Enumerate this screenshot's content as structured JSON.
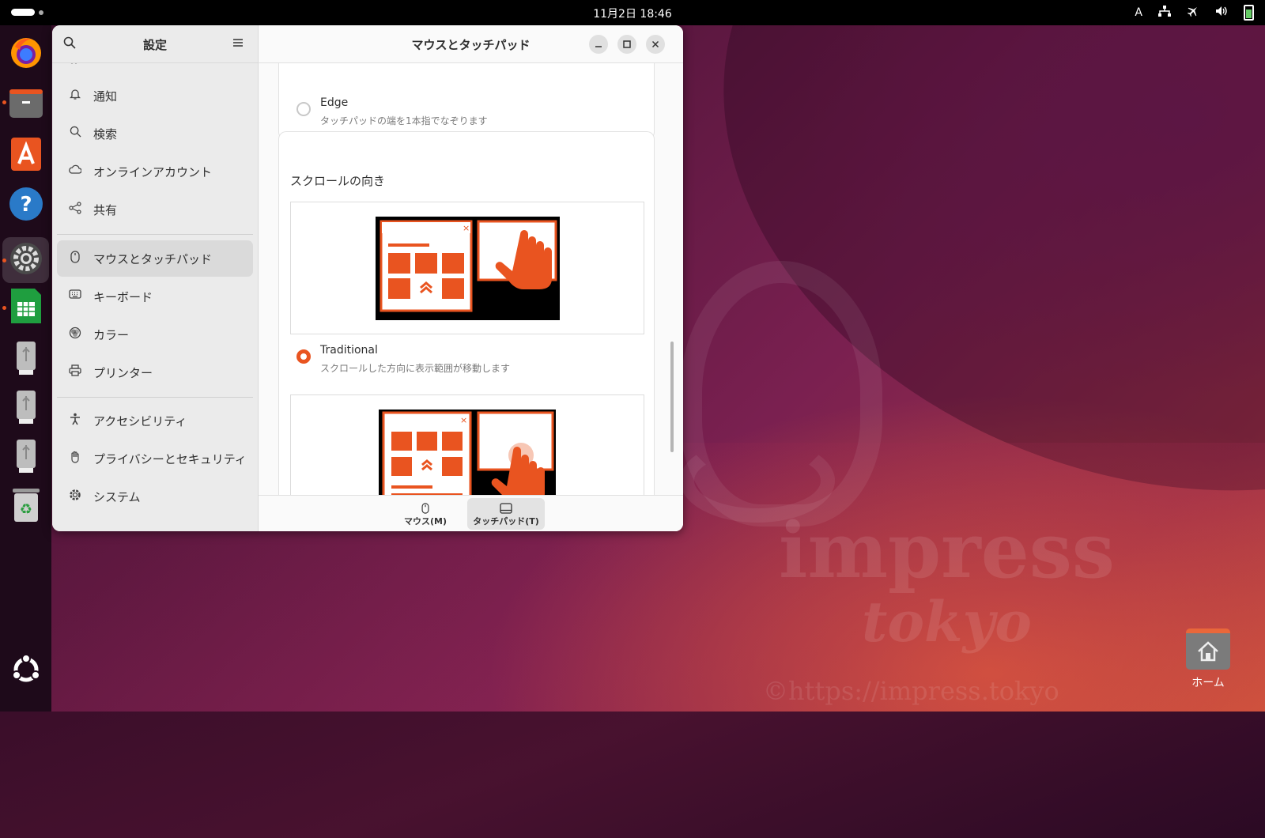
{
  "topbar": {
    "clock": "11月2日  18:46",
    "input_indicator": "A"
  },
  "dock": {
    "items": [
      {
        "name": "firefox",
        "icon": "firefox-icon",
        "color": "#e66000"
      },
      {
        "name": "files",
        "icon": "folder-icon",
        "color": "#6b6b6b"
      },
      {
        "name": "app-center",
        "icon": "app-center-icon",
        "color": "#e95420"
      },
      {
        "name": "help",
        "icon": "help-icon",
        "color": "#2a7ac8"
      },
      {
        "name": "settings",
        "icon": "gear-icon",
        "color": "#4a4a4a"
      },
      {
        "name": "libreoffice-calc",
        "icon": "spreadsheet-icon",
        "color": "#1f9e3f"
      },
      {
        "name": "usb-drive-1",
        "icon": "usb-drive-icon",
        "color": "#bdbdbd"
      },
      {
        "name": "usb-drive-2",
        "icon": "usb-drive-icon",
        "color": "#bdbdbd"
      },
      {
        "name": "usb-drive-3",
        "icon": "usb-drive-icon",
        "color": "#bdbdbd"
      },
      {
        "name": "trash",
        "icon": "trash-icon",
        "color": "#d0d0d0"
      }
    ]
  },
  "desktop": {
    "home_label": "ホーム",
    "watermark_line1": "impress",
    "watermark_line2": "tokyo",
    "watermark_url": "©https://impress.tokyo"
  },
  "settings": {
    "sidebar_title": "設定",
    "items": [
      {
        "label": "通知",
        "icon": "bell-icon"
      },
      {
        "label": "検索",
        "icon": "search-icon"
      },
      {
        "label": "オンラインアカウント",
        "icon": "cloud-icon"
      },
      {
        "label": "共有",
        "icon": "share-icon"
      },
      {
        "label": "マウスとタッチパッド",
        "icon": "mouse-icon",
        "active": true
      },
      {
        "label": "キーボード",
        "icon": "keyboard-icon"
      },
      {
        "label": "カラー",
        "icon": "color-icon"
      },
      {
        "label": "プリンター",
        "icon": "printer-icon"
      },
      {
        "label": "アクセシビリティ",
        "icon": "accessibility-icon"
      },
      {
        "label": "プライバシーとセキュリティ",
        "icon": "hand-icon"
      },
      {
        "label": "システム",
        "icon": "system-gear-icon"
      }
    ],
    "page_title": "マウスとタッチパッド",
    "edge_option": {
      "title": "Edge",
      "subtitle": "タッチパッドの端を1本指でなぞります",
      "selected": false
    },
    "scroll_section_title": "スクロールの向き",
    "traditional_option": {
      "title": "Traditional",
      "subtitle": "スクロールした方向に表示範囲が移動します",
      "selected": true
    },
    "tabs": [
      {
        "label": "マウス(M)",
        "icon": "mouse-icon",
        "active": false
      },
      {
        "label": "タッチパッド(T)",
        "icon": "touchpad-icon",
        "active": true
      }
    ],
    "accent_color": "#e95420"
  }
}
